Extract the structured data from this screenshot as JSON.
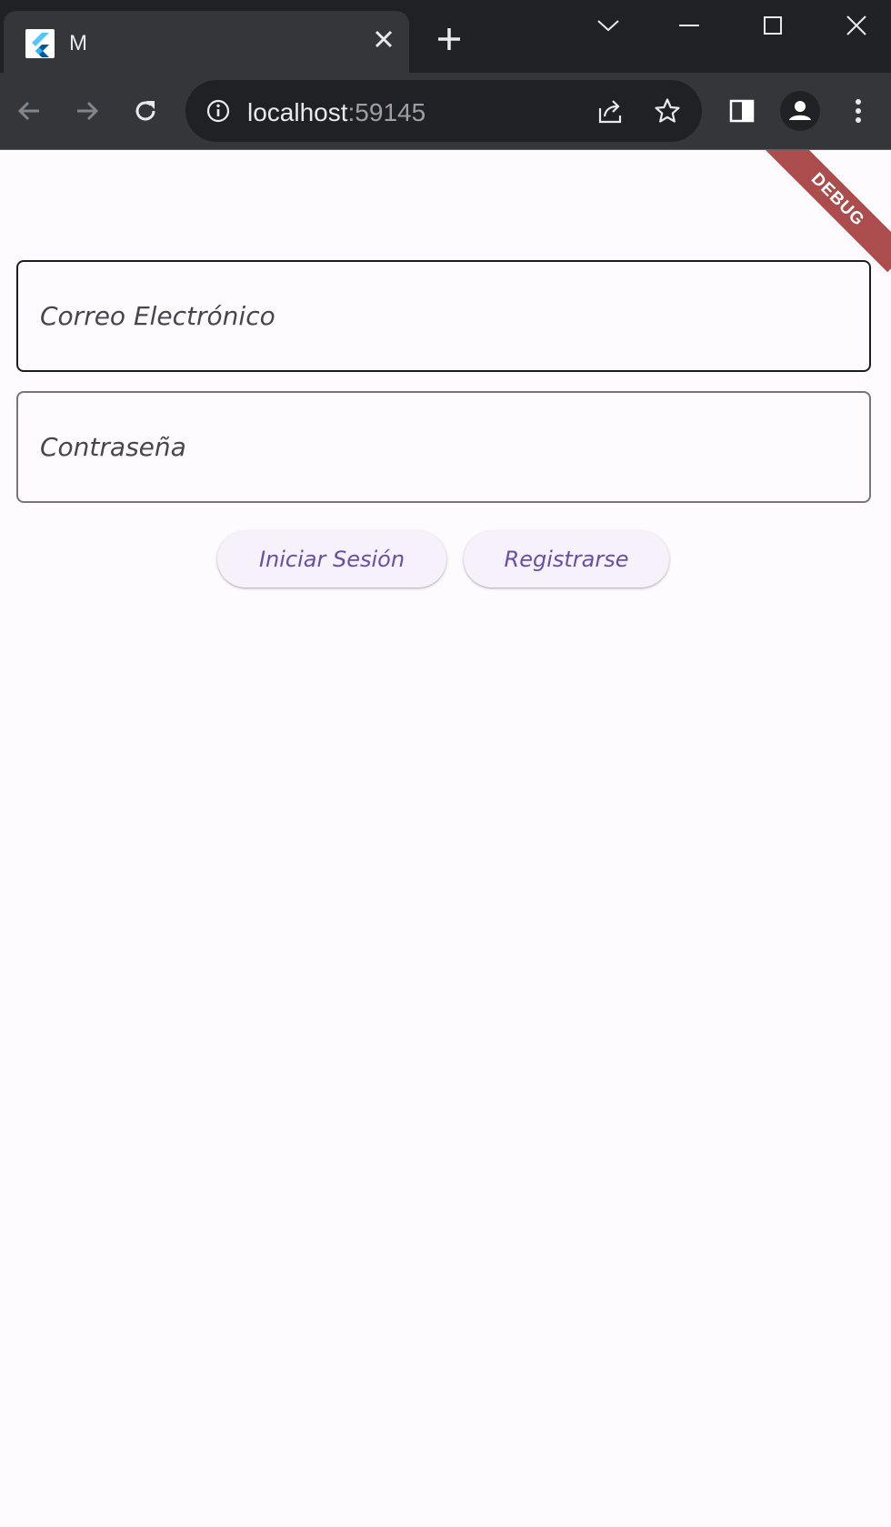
{
  "browser": {
    "tab_title": "M",
    "url_host": "localhost",
    "url_port": ":59145",
    "icons": {
      "favicon": "flutter-logo",
      "tab_close": "close-icon",
      "new_tab": "plus-icon",
      "tab_search": "chevron-down-icon",
      "minimize": "minimize-icon",
      "maximize": "maximize-icon",
      "close_window": "close-icon",
      "back": "arrow-left-icon",
      "forward": "arrow-right-icon",
      "reload": "reload-icon",
      "site_info": "info-icon",
      "share": "share-icon",
      "bookmark": "star-icon",
      "side_panel": "side-panel-icon",
      "profile": "profile-icon",
      "menu": "kebab-menu-icon"
    }
  },
  "form": {
    "email_placeholder": "Correo Electrónico",
    "password_placeholder": "Contraseña",
    "login_label": "Iniciar Sesión",
    "register_label": "Registrarse"
  },
  "debug_banner": "DEBUG",
  "colors": {
    "chrome_dark": "#202124",
    "chrome_toolbar": "#35363a",
    "app_background": "#fdfbfe",
    "button_background": "#f6f1fb",
    "button_text": "#6750a4",
    "debug_banner": "#a33a3a"
  }
}
